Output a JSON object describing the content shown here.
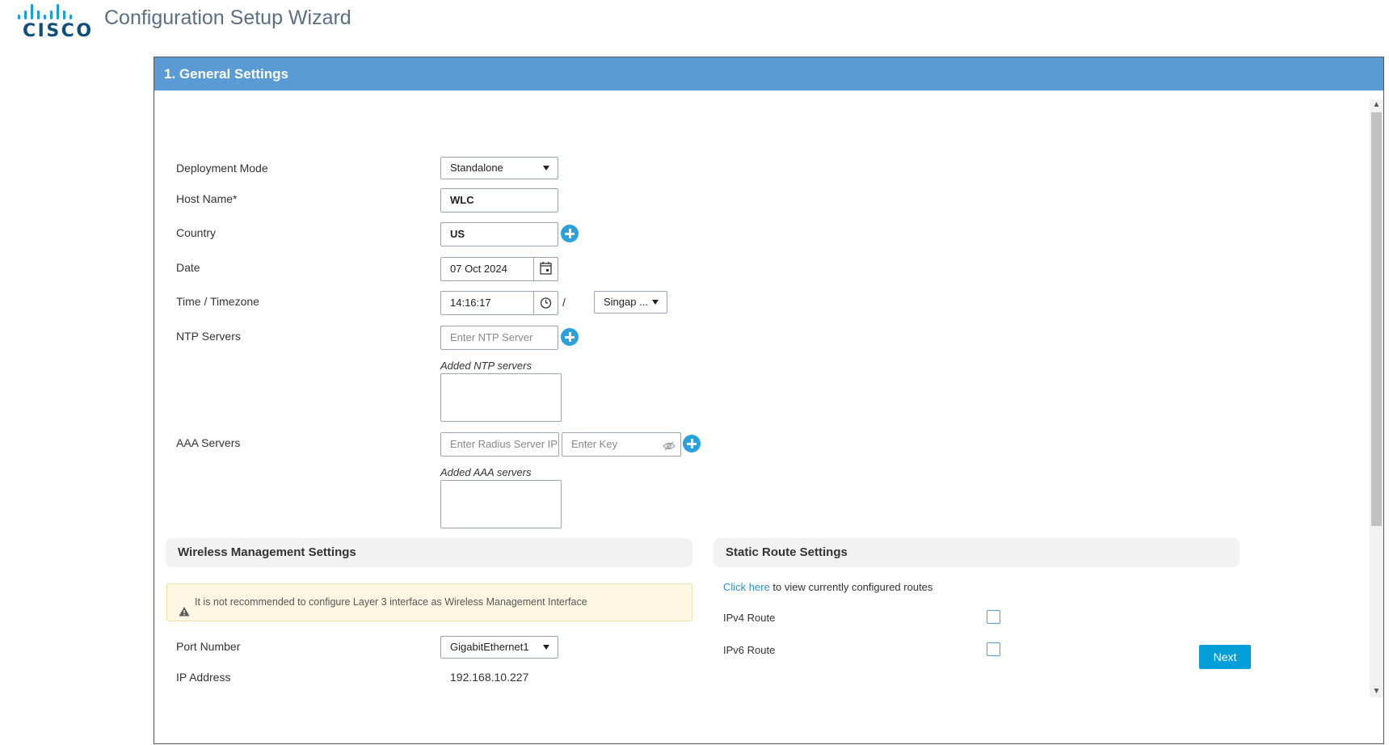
{
  "app": {
    "title": "Configuration Setup Wizard",
    "logo_text": "CISCO"
  },
  "step": {
    "title": "1. General Settings"
  },
  "general": {
    "deployment_mode": {
      "label": "Deployment Mode",
      "value": "Standalone"
    },
    "host_name": {
      "label": "Host Name*",
      "value": "WLC"
    },
    "country": {
      "label": "Country",
      "value": "US"
    },
    "date": {
      "label": "Date",
      "value": "07 Oct 2024"
    },
    "time": {
      "label": "Time / Timezone",
      "value": "14:16:17",
      "separator": "/",
      "timezone": "Singap ..."
    },
    "ntp": {
      "label": "NTP Servers",
      "placeholder": "Enter NTP Server",
      "added_label": "Added NTP servers"
    },
    "aaa": {
      "label": "AAA Servers",
      "ip_placeholder": "Enter Radius Server IP",
      "key_placeholder": "Enter Key",
      "added_label": "Added AAA servers"
    }
  },
  "wireless": {
    "title": "Wireless Management Settings",
    "warning": "It is not recommended to configure Layer 3 interface as Wireless Management Interface",
    "port_number": {
      "label": "Port Number",
      "value": "GigabitEthernet1"
    },
    "ip_address": {
      "label": "IP Address",
      "value": "192.168.10.227"
    }
  },
  "static_route": {
    "title": "Static Route Settings",
    "link_text": "Click here",
    "link_suffix": "to view currently configured routes",
    "ipv4": {
      "label": "IPv4 Route",
      "checked": false
    },
    "ipv6": {
      "label": "IPv6 Route",
      "checked": false
    }
  },
  "actions": {
    "next_label": "Next"
  },
  "colors": {
    "header_blue": "#5b9bd5",
    "accent": "#049fd9",
    "link": "#2e8fd3",
    "warning_bg": "#fdf7e3"
  },
  "icons": {
    "add": "plus-circle-icon",
    "calendar": "calendar-icon",
    "clock": "clock-icon",
    "eye": "eye-hidden-icon",
    "warning": "warning-icon"
  }
}
